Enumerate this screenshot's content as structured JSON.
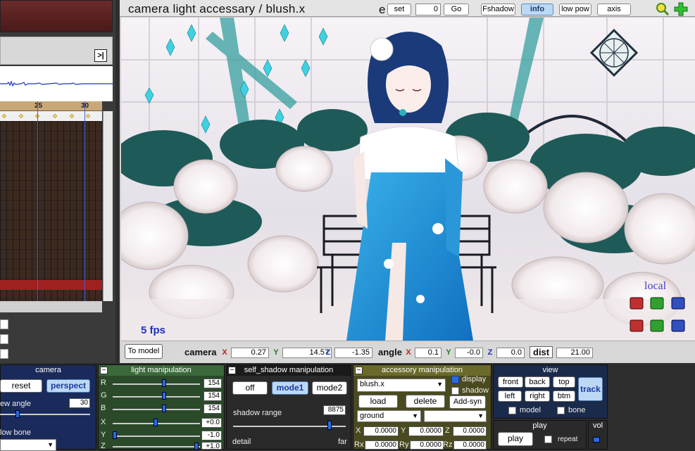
{
  "title": "camera light accessary / blush.x",
  "title_extra": "e",
  "top_buttons": {
    "set": "set",
    "frame": "0",
    "go": "Go",
    "fshadow": "Fshadow",
    "info": "info",
    "lowpow": "low pow",
    "axis": "axis"
  },
  "timeline": {
    "ticks": [
      "25",
      "30"
    ],
    "collapse_label": ">|"
  },
  "viewport": {
    "fps": "5 fps",
    "local": "local"
  },
  "coord": {
    "to_model": "To model",
    "camera_label": "camera",
    "cx": "0.27",
    "cy": "14.57",
    "cz": "-1.35",
    "angle_label": "angle",
    "ax": "0.1",
    "ay": "-0.0",
    "az": "0.0",
    "dist_label": "dist",
    "dist": "21.00",
    "x": "X",
    "y": "Y",
    "z": "Z"
  },
  "camera_panel": {
    "title": "camera",
    "reset": "reset",
    "perspect": "perspect",
    "view_angle_label": "ew angle",
    "view_angle": "30",
    "follow_bone": "low bone"
  },
  "light_panel": {
    "title": "light manipulation",
    "R": "154",
    "G": "154",
    "B": "154",
    "X": "+0.0",
    "Y": "-1.0",
    "Z": "+1.0",
    "labels": [
      "R",
      "G",
      "B",
      "X",
      "Y",
      "Z"
    ]
  },
  "shadow_panel": {
    "title": "self_shadow manipulation",
    "off": "off",
    "mode1": "mode1",
    "mode2": "mode2",
    "range_label": "shadow range",
    "range": "8875",
    "detail": "detail",
    "far": "far"
  },
  "accessory_panel": {
    "title": "accessory manipulation",
    "selected": "blush.x",
    "display": "display",
    "shadow": "shadow",
    "load": "load",
    "delete": "delete",
    "addsyn": "Add-syn",
    "bone": "ground",
    "x": "0.0000",
    "y": "0.0000",
    "z": "0.0000",
    "rx": "0.0000",
    "ry": "0.0000",
    "rz": "0.0000",
    "labels": {
      "x": "X",
      "y": "Y",
      "z": "Z",
      "rx": "Rx",
      "ry": "Ry",
      "rz": "Rz"
    }
  },
  "view_panel": {
    "title": "view",
    "front": "front",
    "back": "back",
    "top": "top",
    "left": "left",
    "right": "right",
    "btm": "btm",
    "track": "track",
    "model": "model",
    "bone": "bone"
  },
  "play_panel": {
    "title": "play",
    "play": "play",
    "repeat": "repeat"
  },
  "vol_panel": {
    "title": "vol"
  },
  "colors": {
    "camera_panel": "#1a2a5a",
    "light_panel": "#2a4a2a",
    "shadow_panel": "#2a2a2a",
    "accessory_panel": "#4a4a20",
    "view_panel": "#1a2a4a",
    "play_panel": "#2a2a2a"
  }
}
